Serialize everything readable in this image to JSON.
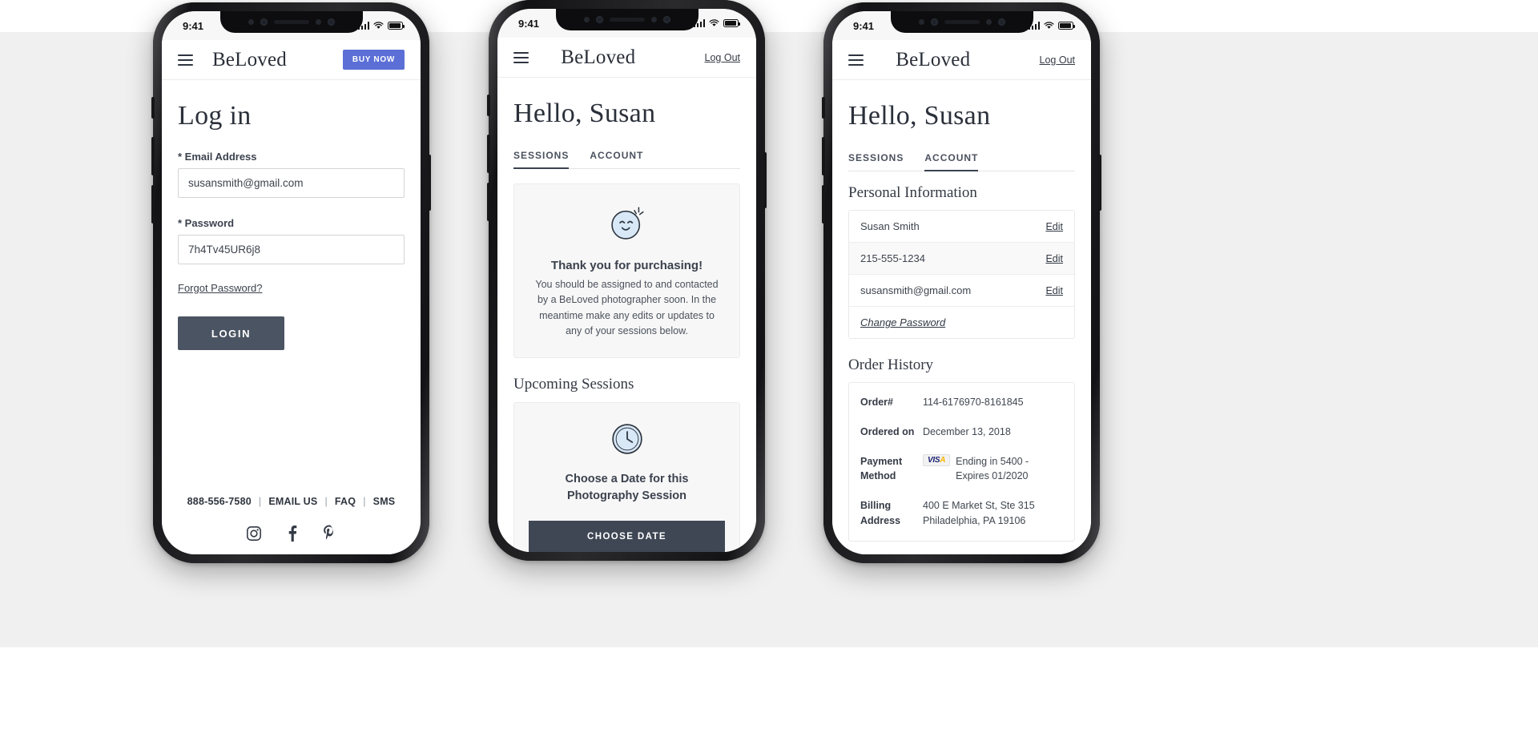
{
  "brand": "BeLoved",
  "status_bar": {
    "time": "9:41"
  },
  "phone1": {
    "topbar": {
      "buy_now": "BUY NOW",
      "menu_icon": "hamburger-icon"
    },
    "title": "Log in",
    "email": {
      "label": "* Email Address",
      "value": "susansmith@gmail.com",
      "placeholder": "Email Address"
    },
    "password": {
      "label": "* Password",
      "value": "7h4Tv45UR6j8",
      "placeholder": "Password"
    },
    "forgot_password": "Forgot Password?",
    "login_button": "LOGIN",
    "footer": {
      "phone": "888-556-7580",
      "email_us": "EMAIL US",
      "faq": "FAQ",
      "sms": "SMS",
      "separator": "|",
      "social": [
        "instagram-icon",
        "facebook-icon",
        "pinterest-icon"
      ]
    }
  },
  "phone2": {
    "topbar": {
      "logout": "Log Out"
    },
    "greeting": "Hello, Susan",
    "tabs": [
      {
        "label": "SESSIONS",
        "active": true
      },
      {
        "label": "ACCOUNT",
        "active": false
      }
    ],
    "thanks_card": {
      "icon": "smiley-face-icon",
      "title": "Thank you for purchasing!",
      "body": "You should be assigned to and contacted by a BeLoved photographer soon. In the meantime make any edits or updates to any of your sessions below."
    },
    "upcoming_heading": "Upcoming Sessions",
    "session_card": {
      "icon": "clock-icon",
      "title": "Choose a Date for this Photography Session",
      "button": "CHOOSE DATE"
    }
  },
  "phone3": {
    "topbar": {
      "logout": "Log Out"
    },
    "greeting": "Hello, Susan",
    "tabs": [
      {
        "label": "SESSIONS",
        "active": false
      },
      {
        "label": "ACCOUNT",
        "active": true
      }
    ],
    "personal_information": {
      "heading": "Personal Information",
      "rows": [
        {
          "value": "Susan Smith",
          "action": "Edit"
        },
        {
          "value": "215-555-1234",
          "action": "Edit"
        },
        {
          "value": "susansmith@gmail.com",
          "action": "Edit"
        }
      ],
      "change_password": "Change Password"
    },
    "order_history": {
      "heading": "Order History",
      "rows": [
        {
          "key": "Order#",
          "value": "114-6176970-8161845"
        },
        {
          "key": "Ordered on",
          "value": "December 13, 2018"
        },
        {
          "key": "Payment Method",
          "value": "Ending in 5400 - Expires 01/2020",
          "card_brand": "VISA"
        },
        {
          "key": "Billing Address",
          "value": "400 E Market St, Ste 315 Philadelphia, PA 19106"
        }
      ]
    }
  },
  "colors": {
    "accent_blue": "#5b6fd6",
    "dark_slate": "#4b5462",
    "text": "#3b424e",
    "card_bg": "#f7f7f7",
    "visa_blue": "#1a1f71",
    "visa_gold": "#f7b600"
  }
}
